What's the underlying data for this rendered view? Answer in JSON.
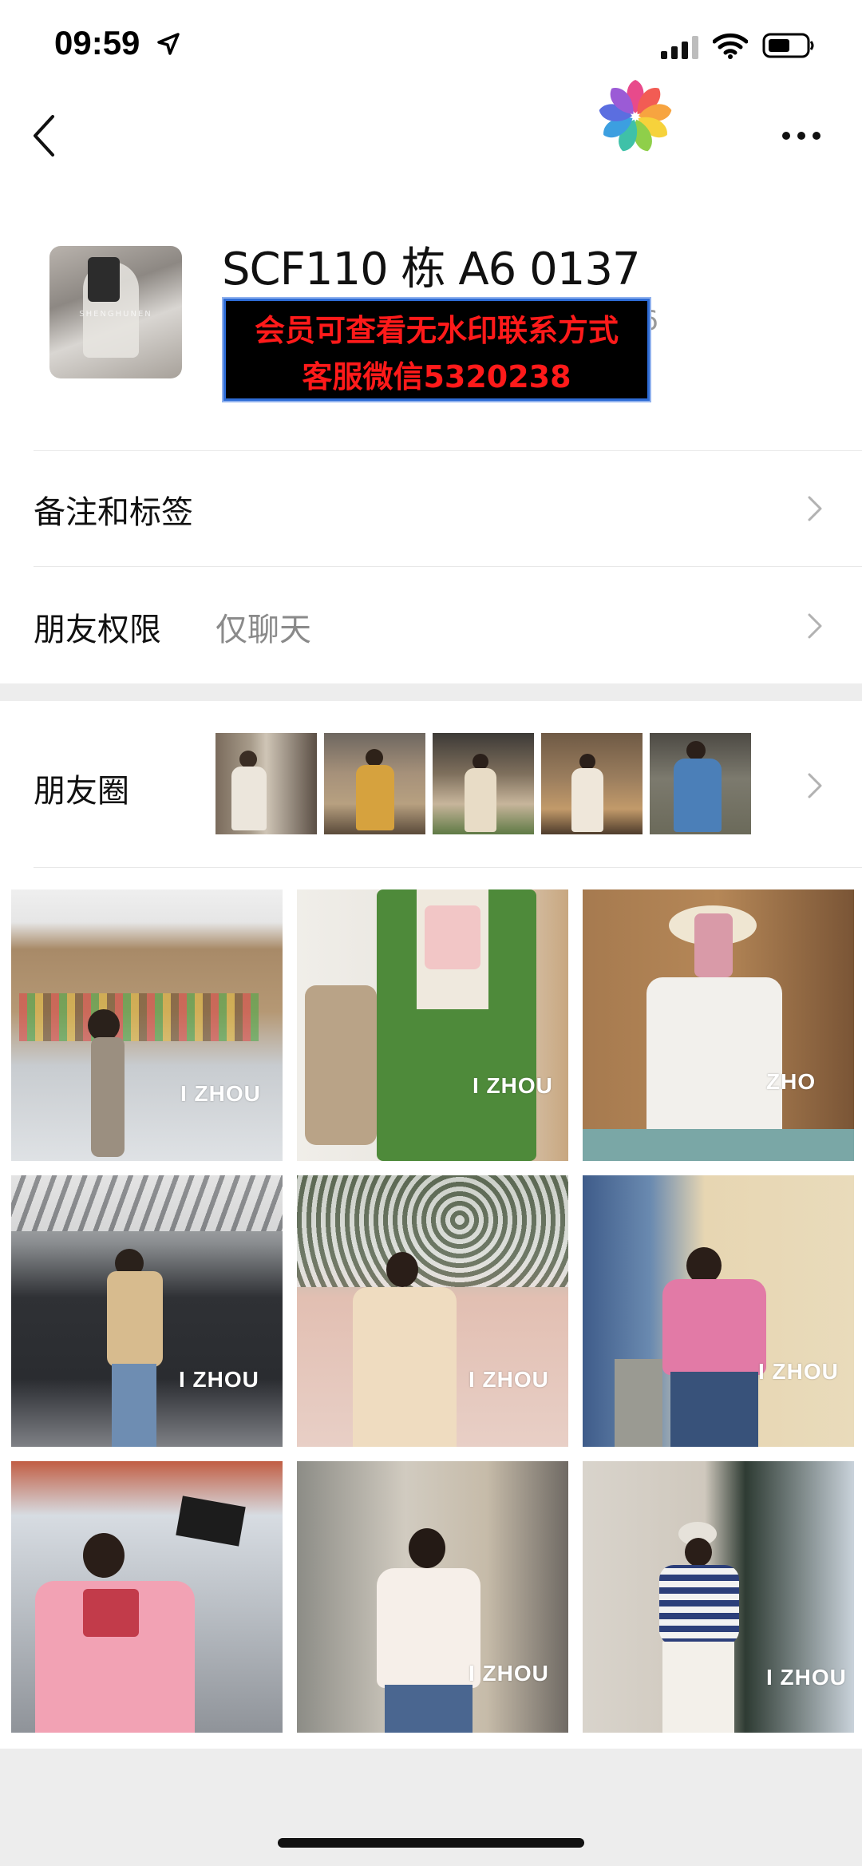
{
  "status_bar": {
    "time": "09:59"
  },
  "nav": {
    "back_icon": "chevron-left-icon",
    "more_icon": "ellipsis-icon"
  },
  "profile": {
    "name": "SCF110 栋 A6 0137",
    "sub_suffix": "​A6",
    "banner_line1": "会员可查看无水印联系方式",
    "banner_line2": "客服微信5320238"
  },
  "rows": {
    "remarks_label": "备注和标签",
    "permissions_label": "朋友权限",
    "permissions_value": "仅聊天",
    "moments_label": "朋友圈"
  },
  "grid": {
    "watermark": "I ZHOU",
    "watermark_partial": "ZHO"
  },
  "colors": {
    "banner_text": "#ff1a1a",
    "banner_bg": "#000000",
    "section_gap": "#ededed",
    "secondary_text": "#8a8a8a"
  }
}
